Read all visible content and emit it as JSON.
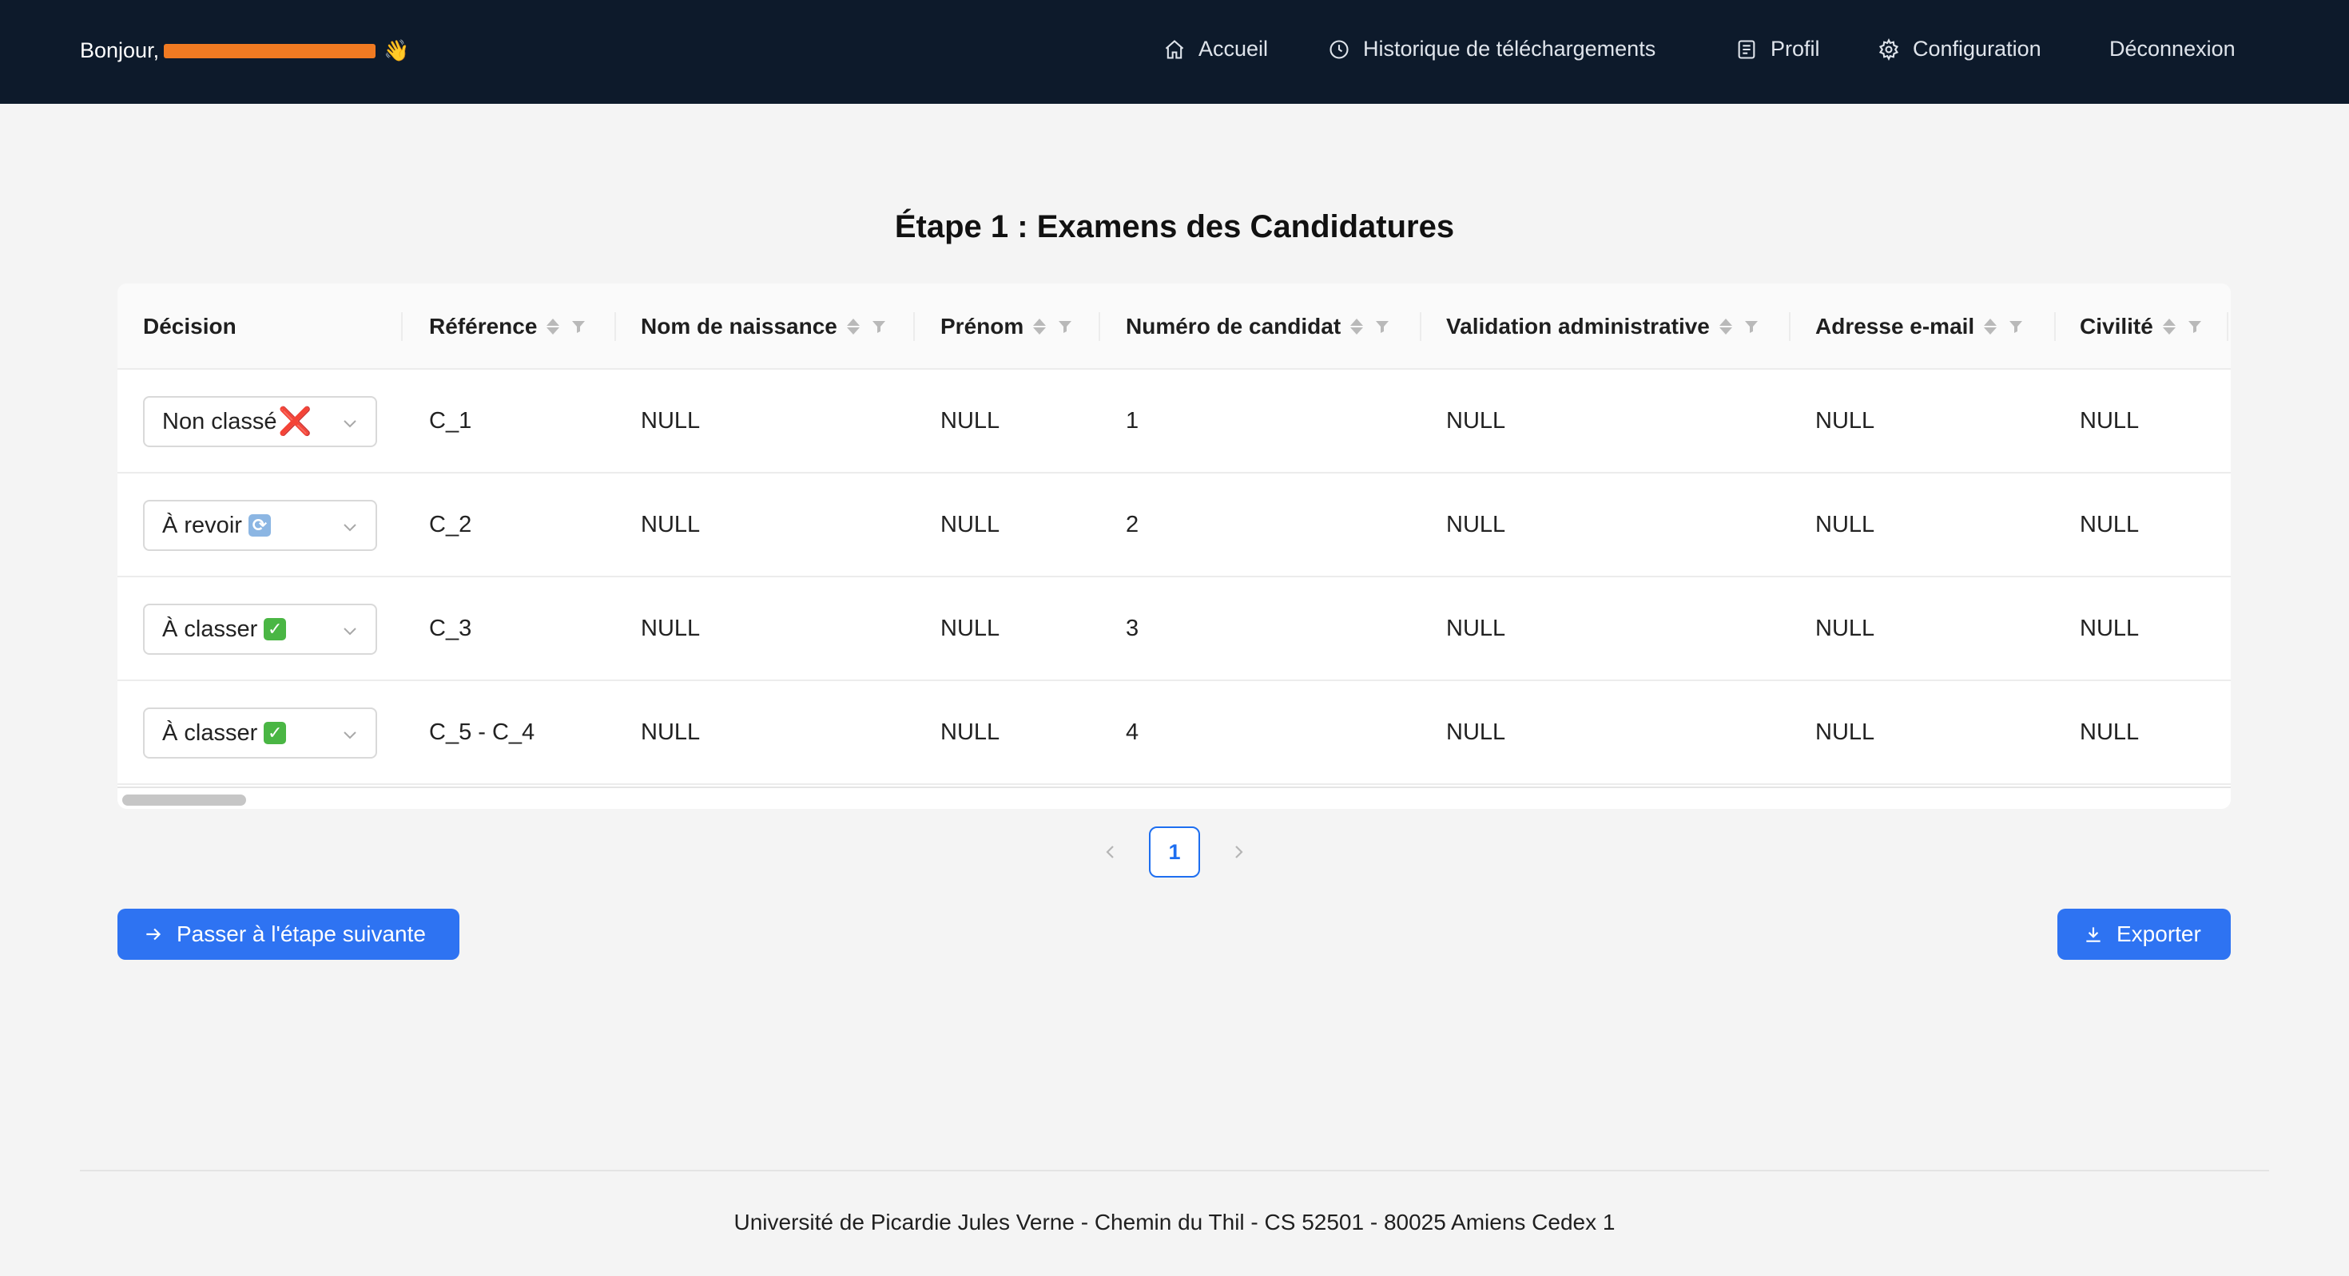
{
  "header": {
    "greeting": "Bonjour,",
    "wave_emoji": "👋",
    "nav": [
      {
        "label": "Accueil",
        "icon": "home-icon"
      },
      {
        "label": "Historique de téléchargements",
        "icon": "history-icon"
      },
      {
        "label": "Profil",
        "icon": "profile-icon"
      },
      {
        "label": "Configuration",
        "icon": "gear-icon"
      },
      {
        "label": "Déconnexion",
        "icon": ""
      }
    ]
  },
  "page": {
    "title": "Étape 1 : Examens des Candidatures"
  },
  "table": {
    "columns": [
      {
        "label": "Décision",
        "sortable": false
      },
      {
        "label": "Référence",
        "sortable": true
      },
      {
        "label": "Nom de naissance",
        "sortable": true
      },
      {
        "label": "Prénom",
        "sortable": true
      },
      {
        "label": "Numéro de candidat",
        "sortable": true
      },
      {
        "label": "Validation administrative",
        "sortable": true
      },
      {
        "label": "Adresse e-mail",
        "sortable": true
      },
      {
        "label": "Civilité",
        "sortable": true
      }
    ],
    "rows": [
      {
        "decision": "Non classé",
        "decision_emoji": "❌",
        "reference": "C_1",
        "nom": "NULL",
        "prenom": "NULL",
        "numero": "1",
        "validation": "NULL",
        "email": "NULL",
        "civilite": "NULL"
      },
      {
        "decision": "À revoir",
        "decision_emoji": "🔄",
        "reference": "C_2",
        "nom": "NULL",
        "prenom": "NULL",
        "numero": "2",
        "validation": "NULL",
        "email": "NULL",
        "civilite": "NULL"
      },
      {
        "decision": "À classer",
        "decision_emoji": "✅",
        "reference": "C_3",
        "nom": "NULL",
        "prenom": "NULL",
        "numero": "3",
        "validation": "NULL",
        "email": "NULL",
        "civilite": "NULL"
      },
      {
        "decision": "À classer",
        "decision_emoji": "✅",
        "reference": "C_5 - C_4",
        "nom": "NULL",
        "prenom": "NULL",
        "numero": "4",
        "validation": "NULL",
        "email": "NULL",
        "civilite": "NULL"
      }
    ]
  },
  "pagination": {
    "current_page": "1"
  },
  "actions": {
    "next_step_label": "Passer à l'étape suivante",
    "export_label": "Exporter"
  },
  "footer": {
    "address": "Université de Picardie Jules Verne - Chemin du Thil - CS 52501 - 80025 Amiens Cedex 1"
  },
  "colors": {
    "header_bg": "#0d1a2b",
    "primary": "#2e73f2",
    "page_bg": "#f4f4f4"
  }
}
